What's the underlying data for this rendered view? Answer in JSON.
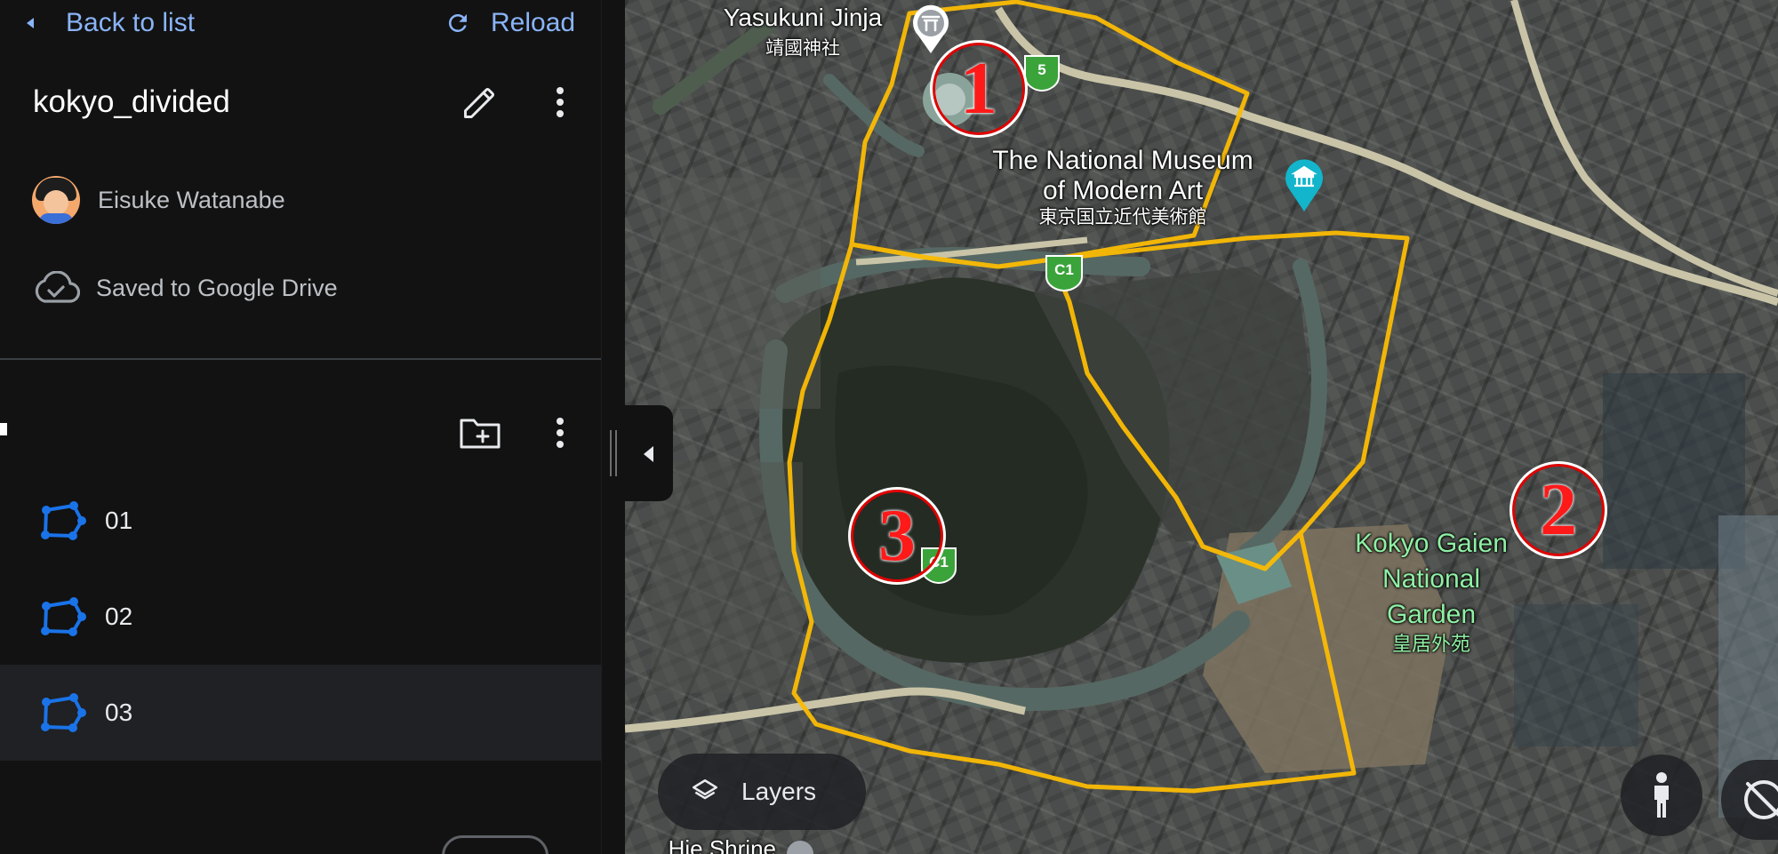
{
  "topbar": {
    "back_label": "Back to list",
    "reload_label": "Reload"
  },
  "map_info": {
    "title": "kokyo_divided",
    "owner": "Eisuke Watanabe",
    "save_status": "Saved to Google Drive"
  },
  "features": [
    {
      "label": "01"
    },
    {
      "label": "02"
    },
    {
      "label": "03"
    }
  ],
  "map": {
    "places": {
      "yasukuni_en": "Yasukuni Jinja",
      "yasukuni_ja": "靖國神社",
      "museum_en_line1": "The National Museum",
      "museum_en_line2": "of Modern Art",
      "museum_ja": "東京国立近代美術館",
      "gaien_line1": "Kokyo Gaien",
      "gaien_line2": "National",
      "gaien_line3": "Garden",
      "gaien_ja": "皇居外苑",
      "hie_shrine": "Hie Shrine"
    },
    "region_numbers": [
      "1",
      "2",
      "3"
    ],
    "route_badges": [
      "5",
      "C1",
      "C1"
    ],
    "layers_label": "Layers"
  },
  "colors": {
    "accent_link": "#8ab4f8",
    "polygon_outline": "#fbbc04",
    "polygon_icon": "#1a73e8",
    "region_number": "#ff1a1a",
    "park_label": "#8ff0a4"
  },
  "icons": [
    "back-arrow-icon",
    "reload-icon",
    "pencil-icon",
    "more-vert-icon",
    "avatar",
    "cloud-done-icon",
    "add-folder-icon",
    "polygon-icon",
    "collapse-arrow-icon",
    "shrine-icon",
    "museum-icon",
    "layers-icon",
    "pegman-icon",
    "compass-icon"
  ]
}
